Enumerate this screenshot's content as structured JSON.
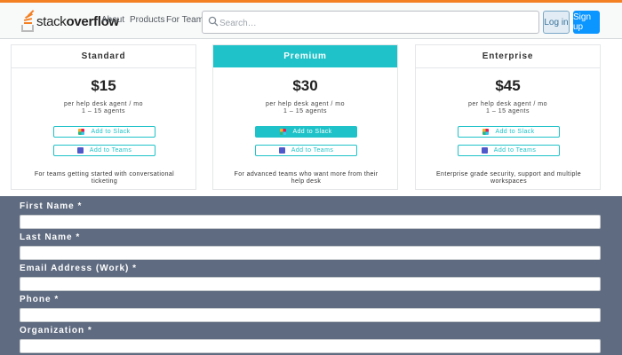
{
  "header": {
    "logo": {
      "text_light": "stack",
      "text_bold": "overflow"
    },
    "nav": [
      "About",
      "Products",
      "For Teams"
    ],
    "search": {
      "placeholder": "Search…",
      "value": ""
    },
    "login_label": "Log in",
    "signup_label": "Sign up",
    "colors": {
      "accent": "#f48024",
      "primary": "#0a95ff"
    }
  },
  "plans": [
    {
      "name": "Standard",
      "price": "$15",
      "per": "per help desk agent / mo",
      "agents": "1 – 15 agents",
      "slack_label": "Add to Slack",
      "teams_label": "Add to Teams",
      "description": "For teams getting started with conversational ticketing"
    },
    {
      "name": "Premium",
      "price": "$30",
      "per": "per help desk agent / mo",
      "agents": "1 – 15 agents",
      "slack_label": "Add to Slack",
      "teams_label": "Add to Teams",
      "description": "For advanced teams who want more from their help desk"
    },
    {
      "name": "Enterprise",
      "price": "$45",
      "per": "per help desk agent / mo",
      "agents": "1 – 15 agents",
      "slack_label": "Add to Slack",
      "teams_label": "Add to Teams",
      "description": "Enterprise grade security, support and multiple workspaces"
    }
  ],
  "plan_colors": {
    "highlight": "#1ec2c8"
  },
  "form": {
    "background": "#5f6b80",
    "fields": [
      {
        "label": "First Name *",
        "value": ""
      },
      {
        "label": "Last Name *",
        "value": ""
      },
      {
        "label": "Email Address (Work) *",
        "value": ""
      },
      {
        "label": "Phone *",
        "value": ""
      },
      {
        "label": "Organization *",
        "value": ""
      }
    ]
  }
}
